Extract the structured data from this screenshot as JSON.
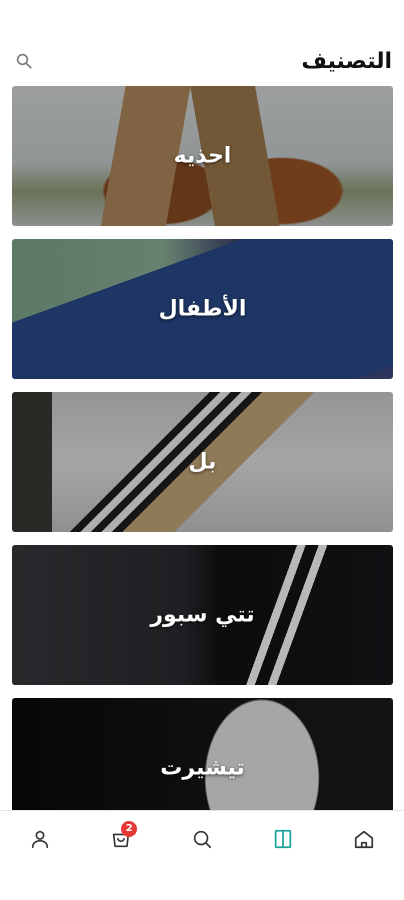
{
  "header": {
    "title": "التصنيف",
    "search_icon": "search-icon"
  },
  "categories": [
    {
      "label": "احذيه",
      "image": "shoes-photo"
    },
    {
      "label": "الأطفال",
      "image": "kids-jeans-photo"
    },
    {
      "label": "بل",
      "image": "pullover-photo"
    },
    {
      "label": "تتي سبور",
      "image": "tracksuit-photo"
    },
    {
      "label": "تيشيرت",
      "image": "tshirt-photo"
    }
  ],
  "bottom_nav": {
    "items": [
      {
        "icon": "user-icon"
      },
      {
        "icon": "cart-icon",
        "badge": "2"
      },
      {
        "icon": "search-icon"
      },
      {
        "icon": "categories-icon",
        "active": true
      },
      {
        "icon": "home-icon"
      }
    ]
  },
  "colors": {
    "accent": "#1aa59a",
    "badge": "#e53935",
    "icon": "#333333"
  }
}
